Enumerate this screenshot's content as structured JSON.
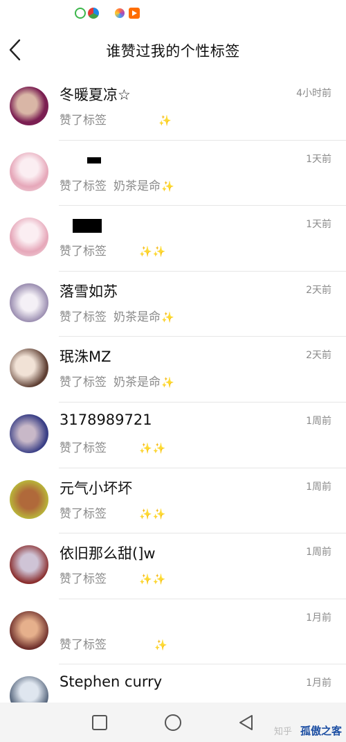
{
  "header": {
    "title": "谁赞过我的个性标签",
    "back_icon": "chevron-left-icon"
  },
  "list": {
    "prefix": "赞了标签",
    "sparkle_glyph": "✨",
    "items": [
      {
        "name": "冬暖夏凉☆",
        "time": "4小时前",
        "tag": "",
        "avatar_colors": [
          "#7b1f52",
          "#d9b6a6"
        ]
      },
      {
        "name": "",
        "time": "1天前",
        "tag": "奶茶是命",
        "avatar_colors": [
          "#f2dde3",
          "#e6a7b9"
        ]
      },
      {
        "name": "",
        "time": "1天前",
        "tag": "",
        "avatar_colors": [
          "#f2dde3",
          "#e6a7b9"
        ]
      },
      {
        "name": "落雪如苏",
        "time": "2天前",
        "tag": "奶茶是命",
        "avatar_colors": [
          "#e9e4ef",
          "#9a8db0"
        ]
      },
      {
        "name": "珉洙MZ",
        "time": "2天前",
        "tag": "奶茶是命",
        "avatar_colors": [
          "#e8d4c4",
          "#5a3a2e"
        ]
      },
      {
        "name": "3178989721",
        "time": "1周前",
        "tag": "",
        "avatar_colors": [
          "#3a3f86",
          "#c8b8c8"
        ]
      },
      {
        "name": "元气小坏坏",
        "time": "1周前",
        "tag": "",
        "avatar_colors": [
          "#b8b43a",
          "#b0693a"
        ]
      },
      {
        "name": "依旧那么甜(]w",
        "time": "1周前",
        "tag": "",
        "avatar_colors": [
          "#8a2e2e",
          "#cfc4d6"
        ]
      },
      {
        "name": "",
        "time": "1月前",
        "tag": "",
        "avatar_colors": [
          "#6e2f2b",
          "#e6b08c"
        ]
      },
      {
        "name": "Stephen curry",
        "time": "1月前",
        "tag": "",
        "avatar_colors": [
          "#4a5a72",
          "#dfe6ef"
        ]
      }
    ]
  },
  "navbar": {
    "square_icon": "recent-apps-square-icon",
    "circle_icon": "home-circle-icon",
    "back_icon": "back-triangle-icon",
    "watermark_text": "孤傲之客",
    "watermark_faint": "知乎"
  },
  "colors": {
    "divider": "#e6e6e6",
    "muted_text": "#8a8a8a",
    "sparkle": "#f2d255",
    "watermark": "#1d4fa3"
  }
}
